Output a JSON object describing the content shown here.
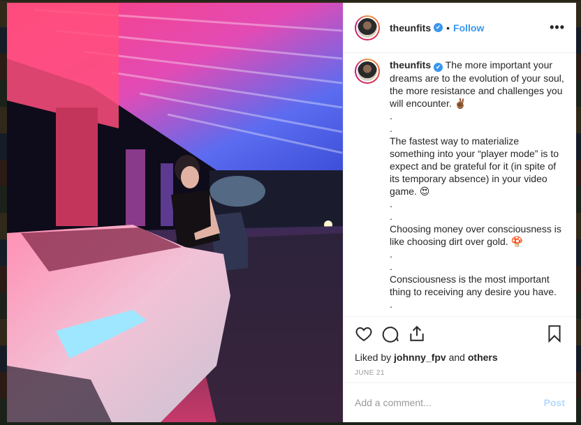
{
  "post": {
    "username": "theunfits",
    "verified_badge": "✔",
    "separator": "•",
    "follow_label": "Follow",
    "more_label": "•••",
    "caption_username": "theunfits",
    "caption_text": "The more important your dreams are to the evolution of your soul, the more resistance and challenges you will encounter. ✌🏾\n.\n.\nThe fastest way to materialize something into your “player mode” is to expect and be grateful for it (in spite of its temporary absence) in your video game. 😍\n.\n.\nChoosing money over consciousness is like choosing dirt over gold. 🍄\n.\n.\nConsciousness is the most important thing to receiving any desire you have.\n.",
    "liked_by_prefix": "Liked by",
    "liked_by_user": "johnny_fpv",
    "liked_by_and": "and",
    "liked_by_others": "others",
    "date": "JUNE 21",
    "comment_placeholder": "Add a comment...",
    "post_label": "Post"
  },
  "icons": {
    "like": "heart-icon",
    "comment": "comment-icon",
    "share": "share-icon",
    "save": "bookmark-icon",
    "verified": "verified-badge-icon"
  },
  "colors": {
    "accent": "#3897f0",
    "post_disabled": "#b3dbff",
    "text": "#262626",
    "muted": "#999999"
  }
}
